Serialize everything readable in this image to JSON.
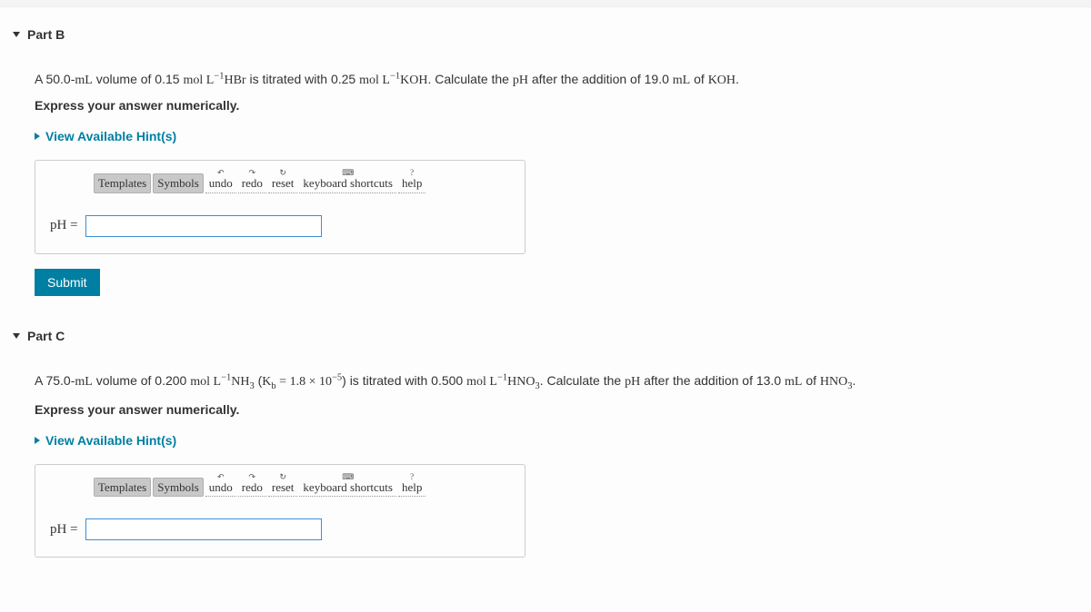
{
  "partB": {
    "title": "Part B",
    "question_html": "A 50.0-<span class='serif'>mL</span> volume of 0.15 <span class='serif'>mol L<sup>−1</sup>HBr</span> is titrated with 0.25 <span class='serif'>mol L<sup>−1</sup>KOH</span>. Calculate the <span class='serif'>pH</span> after the addition of 19.0 <span class='serif'>mL</span> of <span class='serif'>KOH</span>.",
    "express": "Express your answer numerically.",
    "hints": "View Available Hint(s)",
    "ph_label": "pH =",
    "submit": "Submit"
  },
  "partC": {
    "title": "Part C",
    "question_html": "A 75.0-<span class='serif'>mL</span> volume of 0.200 <span class='serif'>mol L<sup>−1</sup>NH<sub>3</sub></span> (<span class='serif'>K<sub>b</sub> = 1.8 × 10<sup>−5</sup></span>) is titrated with 0.500 <span class='serif'>mol L<sup>−1</sup>HNO<sub>3</sub></span>. Calculate the <span class='serif'>pH</span> after the addition of 13.0 <span class='serif'>mL</span> of <span class='serif'>HNO<sub>3</sub></span>.",
    "express": "Express your answer numerically.",
    "hints": "View Available Hint(s)",
    "ph_label": "pH ="
  },
  "toolbar": {
    "templates": "Templates",
    "symbols": "Symbols",
    "undo": "undo",
    "redo": "redo",
    "reset": "reset",
    "keyboard_shortcuts": "keyboard shortcuts",
    "help": "help"
  }
}
